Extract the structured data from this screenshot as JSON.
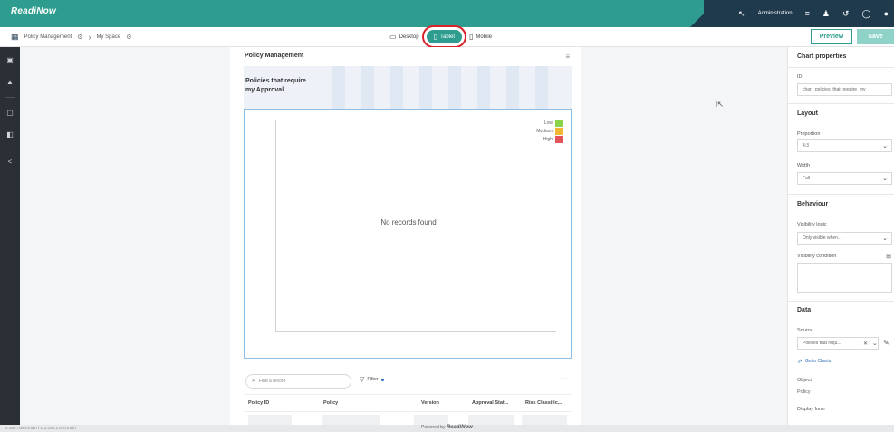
{
  "topbar": {
    "brand": "ReadiNow",
    "brand_sub": "",
    "admin_label": "Administration",
    "icons": [
      "collapse-arrow-icon",
      "menu-icon",
      "user-icon",
      "history-icon",
      "chat-icon",
      "help-icon"
    ]
  },
  "subbar": {
    "app_name": "Policy Management",
    "space_name": "My Space",
    "devices": {
      "desktop": "Desktop",
      "tablet": "Tablet",
      "mobile": "Mobile",
      "selected": "Tablet"
    },
    "preview_label": "Preview",
    "save_label": "Save"
  },
  "canvas": {
    "page_title": "Policy Management",
    "widget_title": "Policies that require my Approval",
    "no_records": "No records found",
    "legend": [
      {
        "label": "Low",
        "color": "#8bd44a"
      },
      {
        "label": "Medium",
        "color": "#f2b632"
      },
      {
        "label": "High",
        "color": "#e2545a"
      }
    ],
    "search_placeholder": "Find a record",
    "filter_label": "Filter",
    "more_label": "···",
    "columns": [
      "Policy ID",
      "Policy",
      "Version",
      "Approval Stat...",
      "Risk Classific..."
    ]
  },
  "props": {
    "title": "Chart properties",
    "id_label": "ID",
    "id_value": "chart_policies_that_require_my_",
    "layout_title": "Layout",
    "proportion_label": "Proportion",
    "proportion_value": "4:3",
    "width_label": "Width",
    "width_value": "Full",
    "behaviour_title": "Behaviour",
    "visibility_logic_label": "Visibility logic",
    "visibility_logic_value": "Only visible when...",
    "visibility_condition_label": "Visibility condition",
    "data_title": "Data",
    "source_label": "Source",
    "source_value": "Policies that requ...",
    "goto_label": "Go to Charts",
    "object_label": "Object",
    "object_value": "Policy",
    "display_form_label": "Display form"
  },
  "footer": {
    "left": "2.190.706.0.main / C.2.190.276.0.main",
    "center_prefix": "Powered by",
    "center_brand": "ReadiNow"
  },
  "colors": {
    "brand": "#2e9c8e",
    "dark": "#1f3a4d",
    "rail": "#2b2f36",
    "highlight": "#d9232a"
  }
}
